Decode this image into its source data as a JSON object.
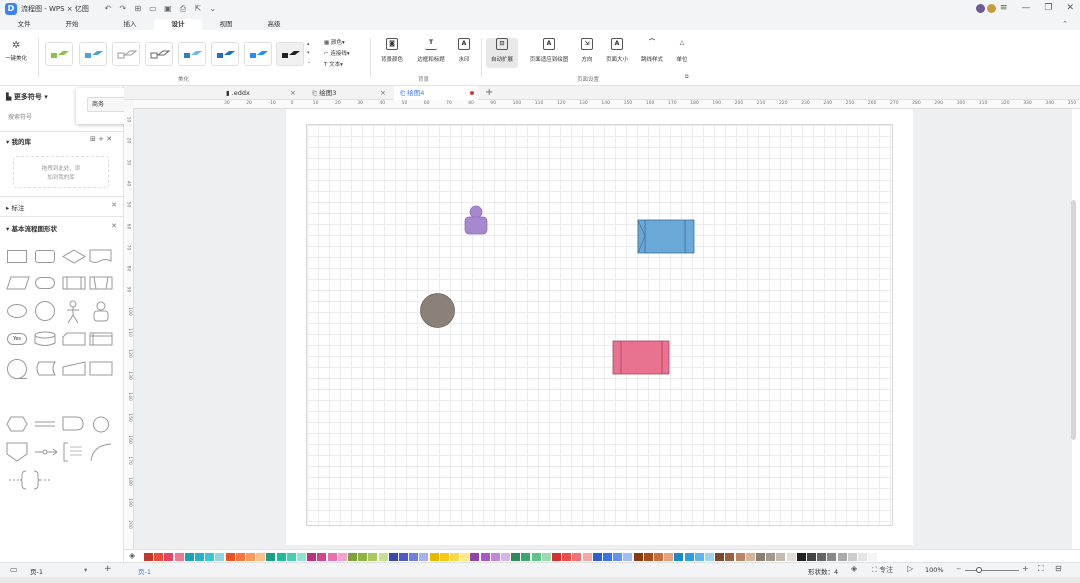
{
  "app": {
    "title": "流程图 - WPS × 亿图",
    "logo": "D"
  },
  "menu": {
    "items": [
      "文件",
      "开始",
      "插入",
      "设计",
      "视图",
      "高级"
    ]
  },
  "ribbon": {
    "beautify_label": "一键美化",
    "group_beautify": "美化",
    "group_background": "背景",
    "group_page": "页面设置",
    "opt_color": "颜色",
    "opt_connector": "连接线",
    "opt_text": "文本",
    "bg_color": "背景颜色",
    "border_title": "边框和标题",
    "watermark": "水印",
    "auto_expand": "自动扩展",
    "fit_page": "页面适应到绘图",
    "orientation": "方向",
    "page_size": "页面大小",
    "jump_style": "跳线样式",
    "unit": "单位"
  },
  "left": {
    "more_symbols": "更多符号",
    "search_placeholder": "搜索符号",
    "popup_value": "商务",
    "my_library": "我的库",
    "drop_hint_1": "拖拽到此处，添",
    "drop_hint_2": "加到我的库",
    "annotation": "标注",
    "basic_flowchart": "基本流程图形状",
    "yes_label": "Yes"
  },
  "tabs": [
    {
      "label": ".eddx"
    },
    {
      "label": "绘图3"
    },
    {
      "label": "绘图4"
    }
  ],
  "ruler": {
    "h": [
      "30",
      "20",
      "-10",
      "0",
      "10",
      "20",
      "30",
      "40",
      "50",
      "60",
      "70",
      "80",
      "90",
      "100",
      "110",
      "120",
      "130",
      "140",
      "150",
      "160",
      "170",
      "180",
      "190",
      "200",
      "210",
      "220",
      "230",
      "240",
      "250",
      "260",
      "270",
      "280",
      "290",
      "300",
      "310",
      "320",
      "330",
      "340",
      "350"
    ],
    "v": [
      "10",
      "20",
      "30",
      "40",
      "50",
      "60",
      "70",
      "80",
      "90",
      "100",
      "110",
      "120",
      "130",
      "140",
      "150",
      "160",
      "170",
      "180",
      "190",
      "200"
    ]
  },
  "palette": [
    "#c0392b",
    "#e74c3c",
    "#e84362",
    "#f07893",
    "#17a2b8",
    "#1fb5c7",
    "#3cc5d6",
    "#8fd7e3",
    "#e95420",
    "#f5753a",
    "#f89a5d",
    "#fbbf8e",
    "#16a085",
    "#1abc9c",
    "#3fd1b4",
    "#8ee4cf",
    "#b83280",
    "#d5438f",
    "#e871ae",
    "#f2a5cc",
    "#7fa03a",
    "#8db43f",
    "#a8c95d",
    "#c9dd96",
    "#3949ab",
    "#4c5dc7",
    "#6d7de0",
    "#a5b0ee",
    "#e6b800",
    "#f7c815",
    "#f9d94c",
    "#fbe98a",
    "#8e44ad",
    "#a55ac7",
    "#c185db",
    "#d8b4ea",
    "#2e8b57",
    "#3aa86a",
    "#5ec48b",
    "#9adbb3",
    "#d63031",
    "#ee4b4b",
    "#f37373",
    "#f7a6a6",
    "#2c5fd1",
    "#3a72e8",
    "#6492ef",
    "#9fbbf5",
    "#8b3a12",
    "#a84b1c",
    "#c9703f",
    "#e2a37f",
    "#1e88c8",
    "#2ea0e0",
    "#5cb8ea",
    "#9ed2f3",
    "#7b4a2d",
    "#98603f",
    "#b88565",
    "#d6b39d",
    "#8a7f73",
    "#a39a8f",
    "#c4bcb2",
    "#e2ddd6",
    "#222222",
    "#444444",
    "#666666",
    "#888888",
    "#aaaaaa",
    "#cccccc",
    "#e5e5e5",
    "#f5f5f5"
  ],
  "status": {
    "page_left": "页-1",
    "page_tab": "页-1",
    "shape_count_label": "形状数：4",
    "focus": "专注",
    "zoom": "100%"
  }
}
